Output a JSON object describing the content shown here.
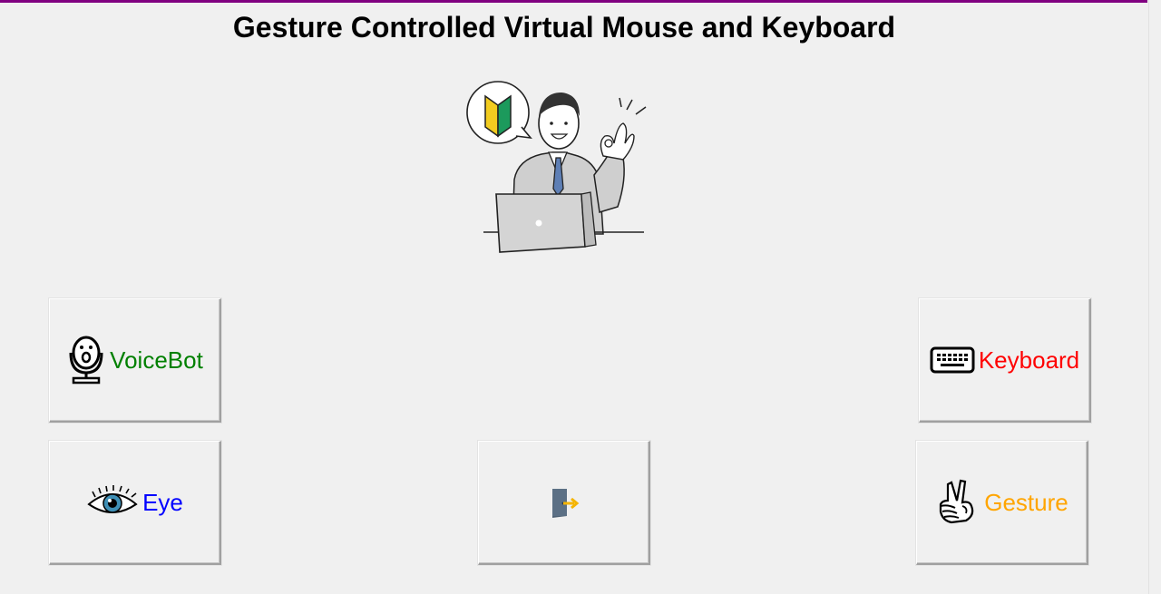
{
  "window": {
    "title": "Gesture Controlled Virtual Mouse and Keyboard",
    "accent_color": "#800080"
  },
  "hero": {
    "icon": "businessman-laptop-ok-gesture-illustration"
  },
  "buttons": {
    "voicebot": {
      "label": "VoiceBot",
      "color": "#008000",
      "icon": "microphone-icon"
    },
    "keyboard": {
      "label": "Keyboard",
      "color": "#ff0000",
      "icon": "keyboard-icon"
    },
    "eye": {
      "label": "Eye",
      "color": "#0000ff",
      "icon": "eye-icon"
    },
    "exit": {
      "label": "",
      "icon": "exit-door-icon"
    },
    "gesture": {
      "label": "Gesture",
      "color": "#ffa500",
      "icon": "victory-hand-icon"
    }
  }
}
